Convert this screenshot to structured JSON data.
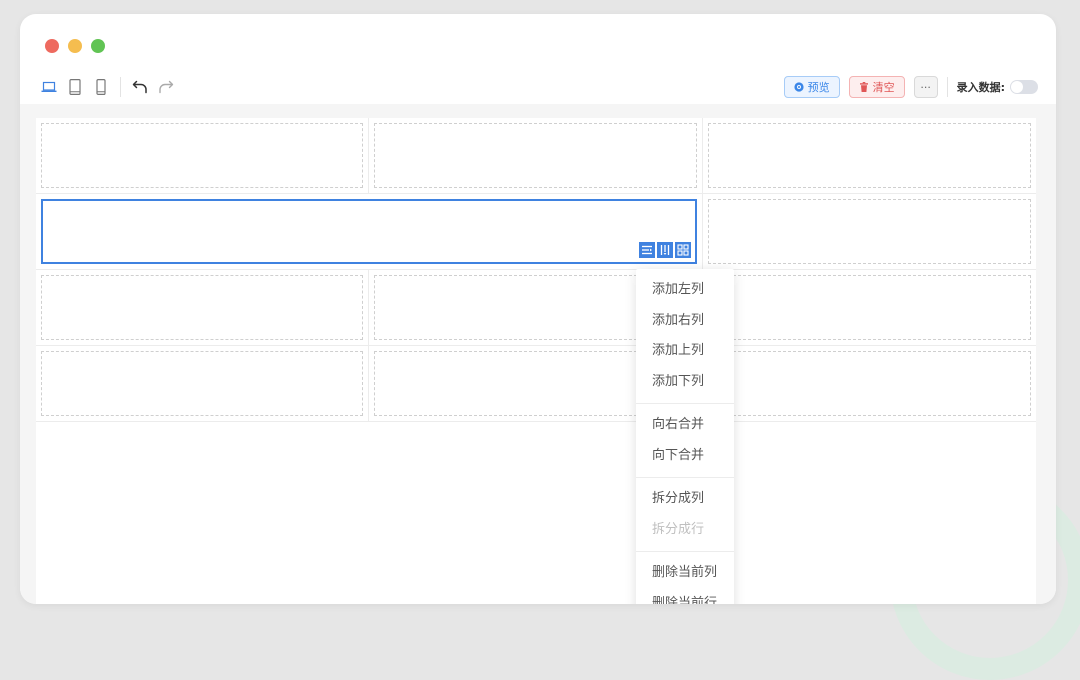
{
  "toolbar": {
    "preview_label": "预览",
    "clear_label": "清空",
    "more_label": "···",
    "enter_data_label": "录入数据:"
  },
  "context_menu": {
    "items": [
      {
        "label": "添加左列",
        "disabled": false
      },
      {
        "label": "添加右列",
        "disabled": false
      },
      {
        "label": "添加上列",
        "disabled": false
      },
      {
        "label": "添加下列",
        "disabled": false
      },
      {
        "label": "向右合并",
        "disabled": false
      },
      {
        "label": "向下合并",
        "disabled": false
      },
      {
        "label": "拆分成列",
        "disabled": false
      },
      {
        "label": "拆分成行",
        "disabled": true
      },
      {
        "label": "删除当前列",
        "disabled": false
      },
      {
        "label": "删除当前行",
        "disabled": false
      }
    ]
  },
  "icons": {
    "desktop": "laptop-icon",
    "tablet": "tablet-icon",
    "mobile": "mobile-icon",
    "undo": "undo-icon",
    "redo": "redo-icon",
    "preview": "eye-icon",
    "clear": "trash-icon"
  },
  "colors": {
    "accent": "#3f82e0",
    "preview": "#3a86e8",
    "danger": "#e05757"
  }
}
